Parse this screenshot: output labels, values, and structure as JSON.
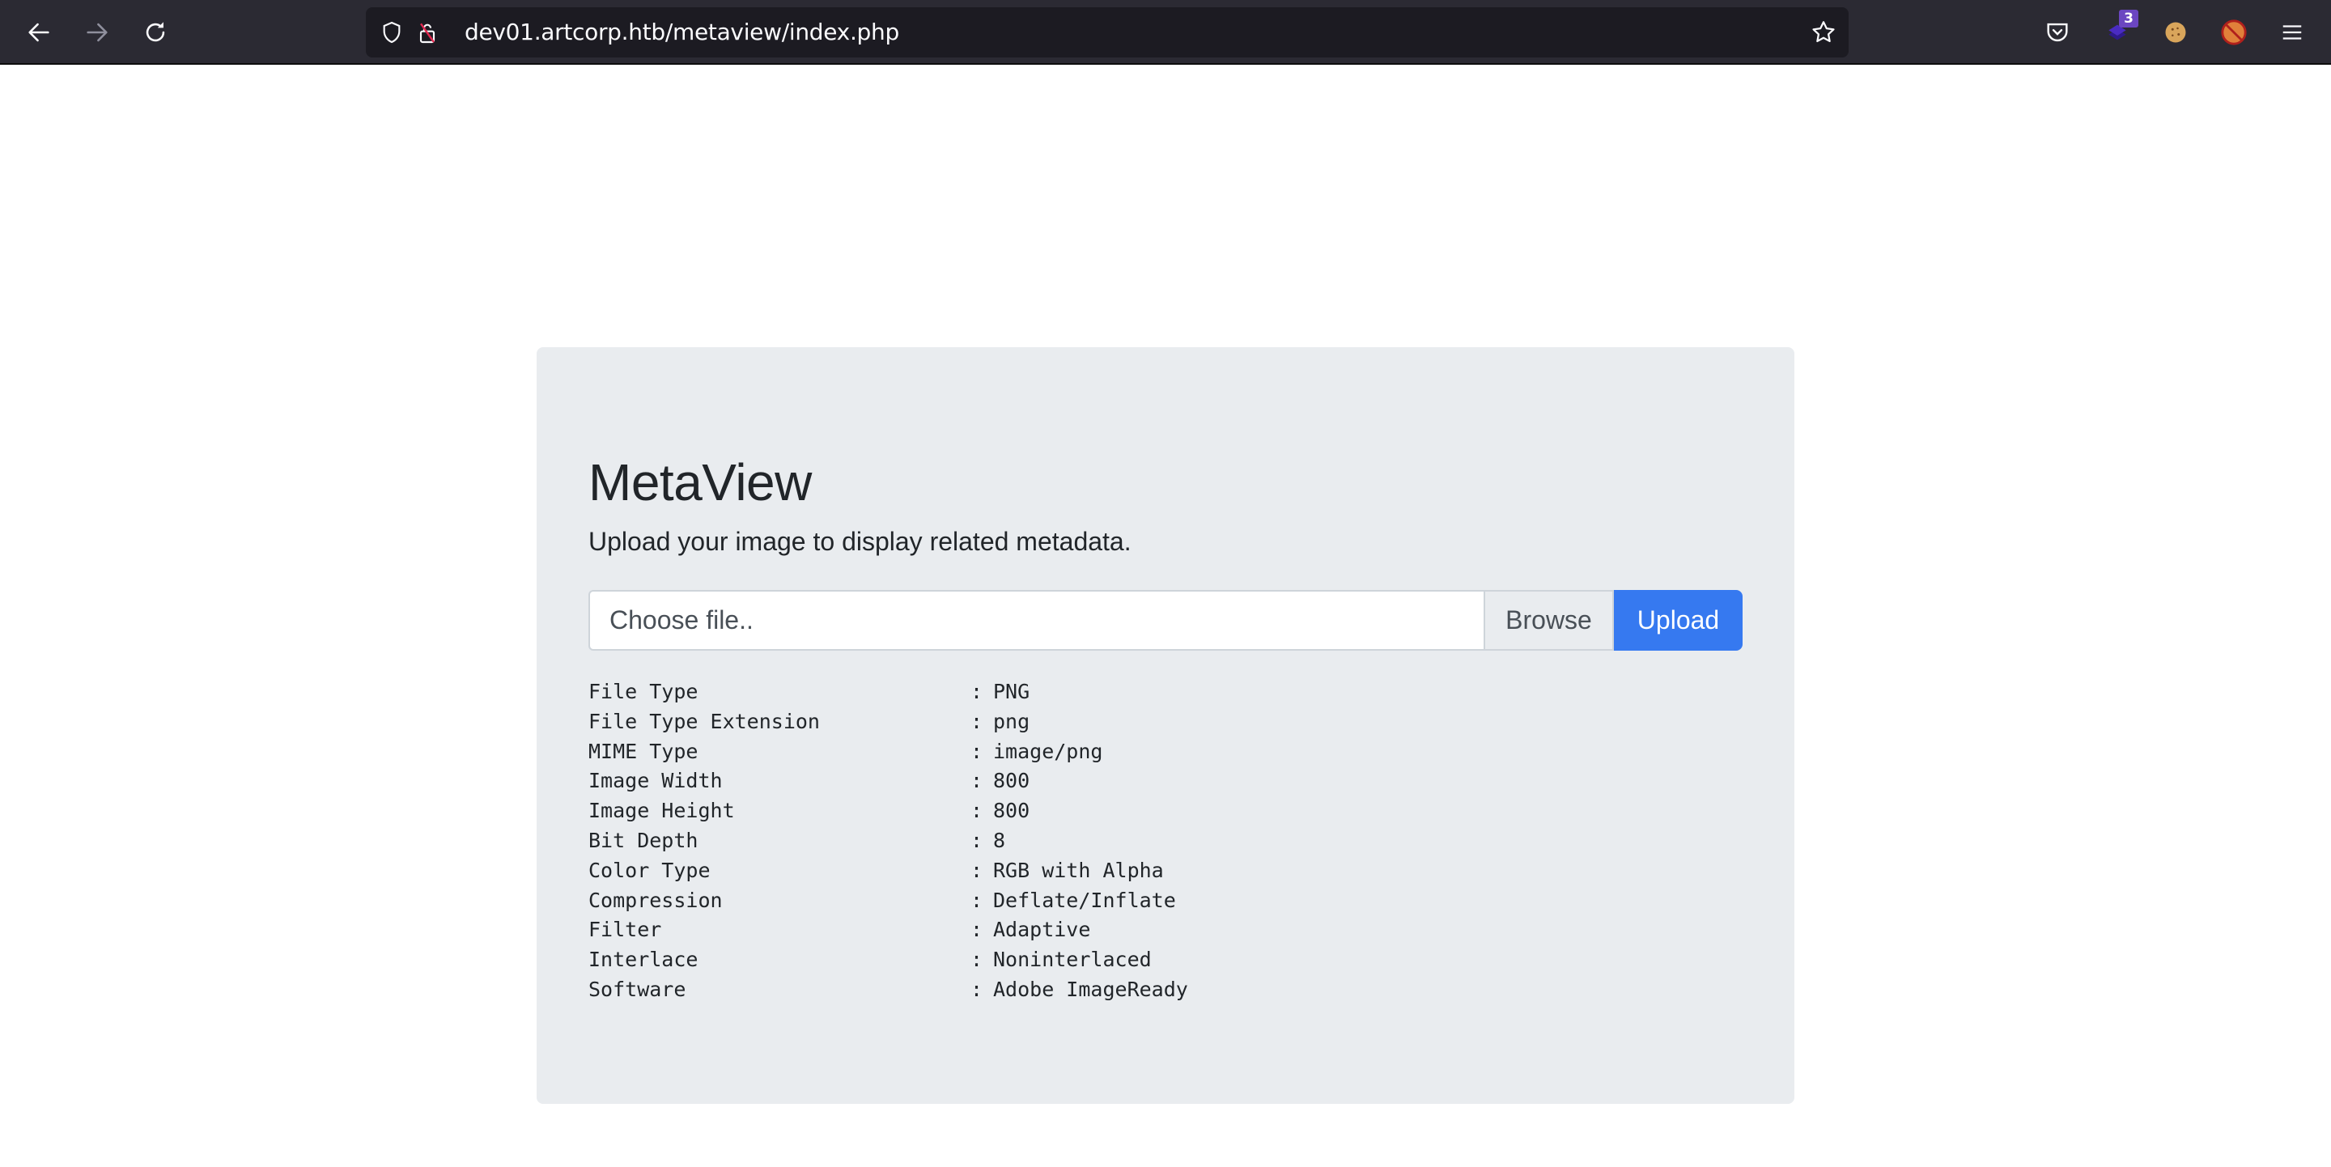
{
  "browser": {
    "url": "dev01.artcorp.htb/metaview/index.php",
    "extension_badge": "3",
    "icons": {
      "back": "arrow-left-icon",
      "forward": "arrow-right-icon",
      "reload": "reload-icon",
      "tracking": "shield-icon",
      "insecure": "insecure-lock-icon",
      "bookmark": "star-icon",
      "pocket": "pocket-icon",
      "menu": "hamburger-menu-icon"
    }
  },
  "page": {
    "title": "MetaView",
    "subtitle": "Upload your image to display related metadata.",
    "file_input": {
      "placeholder": "Choose file..",
      "browse_label": "Browse"
    },
    "upload_label": "Upload",
    "accent_color": "#3679f0",
    "metadata": [
      {
        "key": "File Type",
        "value": "PNG"
      },
      {
        "key": "File Type Extension",
        "value": "png"
      },
      {
        "key": "MIME Type",
        "value": "image/png"
      },
      {
        "key": "Image Width",
        "value": "800"
      },
      {
        "key": "Image Height",
        "value": "800"
      },
      {
        "key": "Bit Depth",
        "value": "8"
      },
      {
        "key": "Color Type",
        "value": "RGB with Alpha"
      },
      {
        "key": "Compression",
        "value": "Deflate/Inflate"
      },
      {
        "key": "Filter",
        "value": "Adaptive"
      },
      {
        "key": "Interlace",
        "value": "Noninterlaced"
      },
      {
        "key": "Software",
        "value": "Adobe ImageReady"
      }
    ],
    "separator": ":"
  }
}
